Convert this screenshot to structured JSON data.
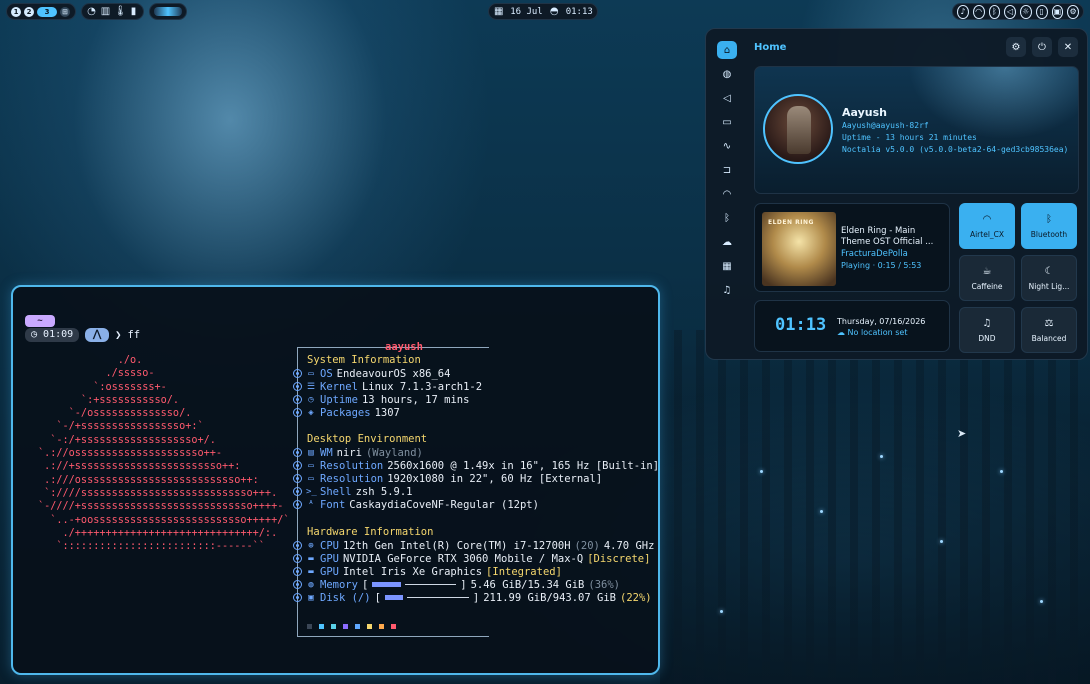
{
  "topbar": {
    "workspaces": [
      "1",
      "2",
      "3"
    ],
    "date": "16 Jul",
    "time": "01:13"
  },
  "terminal": {
    "tag": "~",
    "prompt_time": "01:09",
    "prompt_cmd": "ff",
    "user": "aayush",
    "ascii_logo": [
      "             ./o.",
      "           ./sssso-",
      "         `:osssssss+-",
      "       `:+sssssssssso/.",
      "     `-/ossssssssssssso/.",
      "   `-/+sssssssssssssssso+:`",
      "  `-:/+sssssssssssssssssso+/.",
      "`.://osssssssssssssssssssso++-",
      " .://+ssssssssssssssssssssssso++:",
      " .:///ossssssssssssssssssssssssso++:",
      " `:////ssssssssssssssssssssssssssso+++.",
      "`-////+ssssssssssssssssssssssssssso++++-",
      "  `..-+oosssssssssssssssssssssssso+++++/`",
      "    ./++++++++++++++++++++++++++++++/:.",
      "   `:::::::::::::::::::::::::------``"
    ],
    "sections": {
      "system": "System Information",
      "desktop": "Desktop Environment",
      "hardware": "Hardware Information"
    },
    "rows": {
      "os_k": "OS",
      "os_v": "EndeavourOS x86_64",
      "kernel_k": "Kernel",
      "kernel_v": "Linux 7.1.3-arch1-2",
      "uptime_k": "Uptime",
      "uptime_v": "13 hours, 17 mins",
      "packages_k": "Packages",
      "packages_v": "1307",
      "wm_k": "WM",
      "wm_v": "niri",
      "wm_d": "(Wayland)",
      "res1_k": "Resolution",
      "res1_v": "2560x1600 @ 1.49x in 16\", 165 Hz [Built-in]",
      "res2_k": "Resolution",
      "res2_v": "1920x1080 in 22\", 60 Hz [External]",
      "shell_k": "Shell",
      "shell_v": "zsh 5.9.1",
      "font_k": "Font",
      "font_v": "CaskaydiaCoveNF-Regular (12pt)",
      "cpu_k": "CPU",
      "cpu_v": "12th Gen Intel(R) Core(TM) i7-12700H",
      "cpu_d": "(20)",
      "cpu_f": "4.70 GHz",
      "gpu1_k": "GPU",
      "gpu1_v": "NVIDIA GeForce RTX 3060 Mobile / Max-Q",
      "gpu1_t": "[Discrete]",
      "gpu2_k": "GPU",
      "gpu2_v": "Intel Iris Xe Graphics",
      "gpu2_t": "[Integrated]",
      "mem_k": "Memory",
      "mem_v": "5.46 GiB/15.34 GiB",
      "mem_p": "(36%)",
      "mem_frac": 0.36,
      "disk_k": "Disk (/)",
      "disk_v": "211.99 GiB/943.07 GiB",
      "disk_p": "(22%)",
      "disk_frac": 0.22
    },
    "palette": [
      "#3a4656",
      "#4fc3ff",
      "#5ad1e8",
      "#8c6cff",
      "#5fa8ff",
      "#f5d76e",
      "#ffa94d",
      "#ff5a6e"
    ]
  },
  "panel": {
    "title": "Home",
    "profile": {
      "name": "Aayush",
      "handle": "Aayush@aayush-82rf",
      "uptime": "Uptime - 13 hours 21 minutes",
      "version": "Noctalia v5.0.0 (v5.0.0-beta2-64-ged3cb98536ea)"
    },
    "media": {
      "album_text": "ELDEN RING",
      "title": "Elden Ring - Main Theme OST Official ...",
      "artist": "FracturaDePolla",
      "status": "Playing · 0:15 / 5:53"
    },
    "clock": {
      "time": "01:13",
      "date": "Thursday, 07/16/2026",
      "location": "No location set"
    },
    "tiles": {
      "wifi": "Airtel_CX",
      "bluetooth": "Bluetooth",
      "caffeine": "Caffeine",
      "night": "Night Lig...",
      "dnd": "DND",
      "power": "Balanced"
    }
  }
}
